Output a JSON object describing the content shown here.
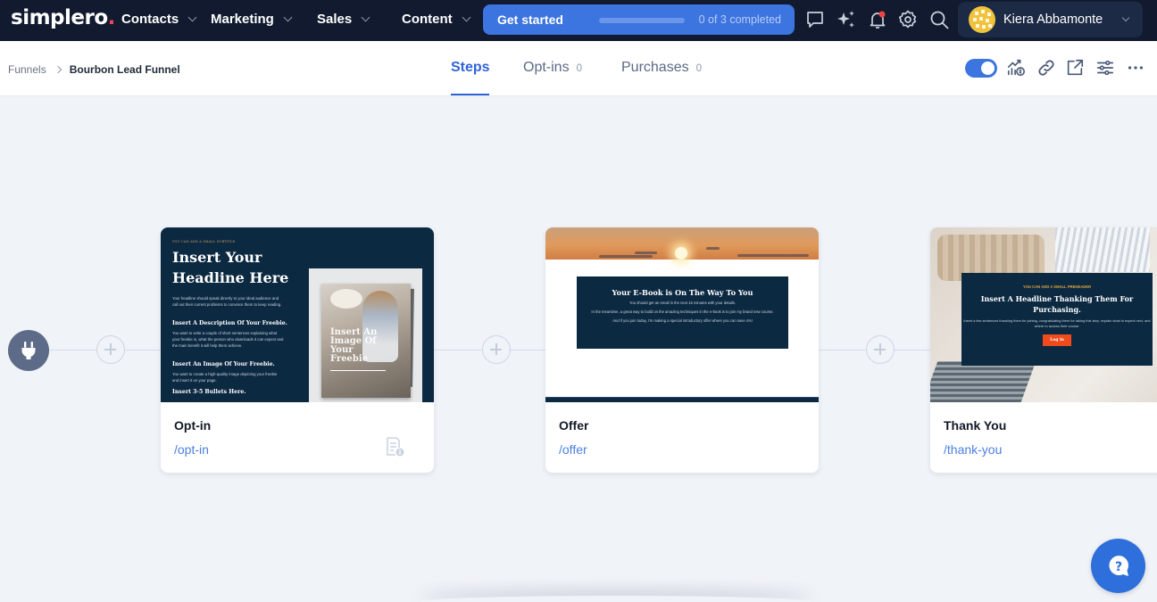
{
  "topnav": {
    "logo": "simplero",
    "logo_dot": ".",
    "menus": [
      {
        "label": "Contacts"
      },
      {
        "label": "Marketing"
      },
      {
        "label": "Sales"
      },
      {
        "label": "Content"
      }
    ],
    "get_started": {
      "label": "Get started",
      "progress_text": "0 of 3 completed",
      "completed": 0,
      "total": 3
    },
    "icons": [
      "chat-icon",
      "sparkles-icon",
      "notification-bell-icon",
      "settings-gear-icon",
      "search-icon"
    ],
    "user": {
      "name": "Kiera Abbamonte"
    }
  },
  "subheader": {
    "breadcrumb": {
      "parent": "Funnels",
      "current": "Bourbon Lead Funnel"
    },
    "tabs": [
      {
        "label": "Steps",
        "count": null,
        "active": true
      },
      {
        "label": "Opt-ins",
        "count": "0",
        "active": false
      },
      {
        "label": "Purchases",
        "count": "0",
        "active": false
      }
    ],
    "toggle_on": true,
    "tools": [
      "analytics-revenue-icon",
      "link-icon",
      "external-link-icon",
      "settings-sliders-icon",
      "more-options-icon"
    ]
  },
  "steps": [
    {
      "title": "Opt-in",
      "path": "/opt-in",
      "preview": {
        "preheader": "YOU CAN ADD A SMALL SUBTITLE",
        "headline": "Insert Your Headline Here",
        "intro": "Your headline should speak directly to your ideal audience and call out their current problems to convince them to keep reading.",
        "sections": [
          {
            "heading": "Insert A Description Of Your Freebie.",
            "text": "You want to write a couple of short sentences explaining what your freebie is, what the person who downloads it can expect and the main benefit it will help them achieve."
          },
          {
            "heading": "Insert An Image Of Your Freebie.",
            "text": "You want to create a high-quality image depicting your freebie and insert it on your page."
          },
          {
            "heading": "Insert 3-5 Bullets Here.",
            "text": ""
          }
        ],
        "book_title": "Insert An Image Of Your Freebie"
      }
    },
    {
      "title": "Offer",
      "path": "/offer",
      "preview": {
        "headline": "Your E-Book is On The Way To You",
        "lines": [
          "You should get an email in the next 15 minutes with your details.",
          "In the meantime, a great way to build on the amazing techniques in the e-book is to join my brand new course.",
          "And if you join today, I'm making a special introductory offer where you can save x%!"
        ]
      }
    },
    {
      "title": "Thank You",
      "path": "/thank-you",
      "preview": {
        "preheader": "YOU CAN ADD A SMALL PREHEADER",
        "headline": "Insert A Headline Thanking Them For Purchasing.",
        "text": "Insert a few sentences thanking them for joining, congratulating them for taking this step, explain what to expect next, and where to access their course.",
        "button": "Log in"
      }
    }
  ],
  "colors": {
    "nav_bg": "#111a2e",
    "accent": "#3c74e0",
    "active_tab": "#2f63d8",
    "link": "#4a7fe3",
    "preview_navy": "#0c2942",
    "notification_dot": "#ef4444"
  }
}
